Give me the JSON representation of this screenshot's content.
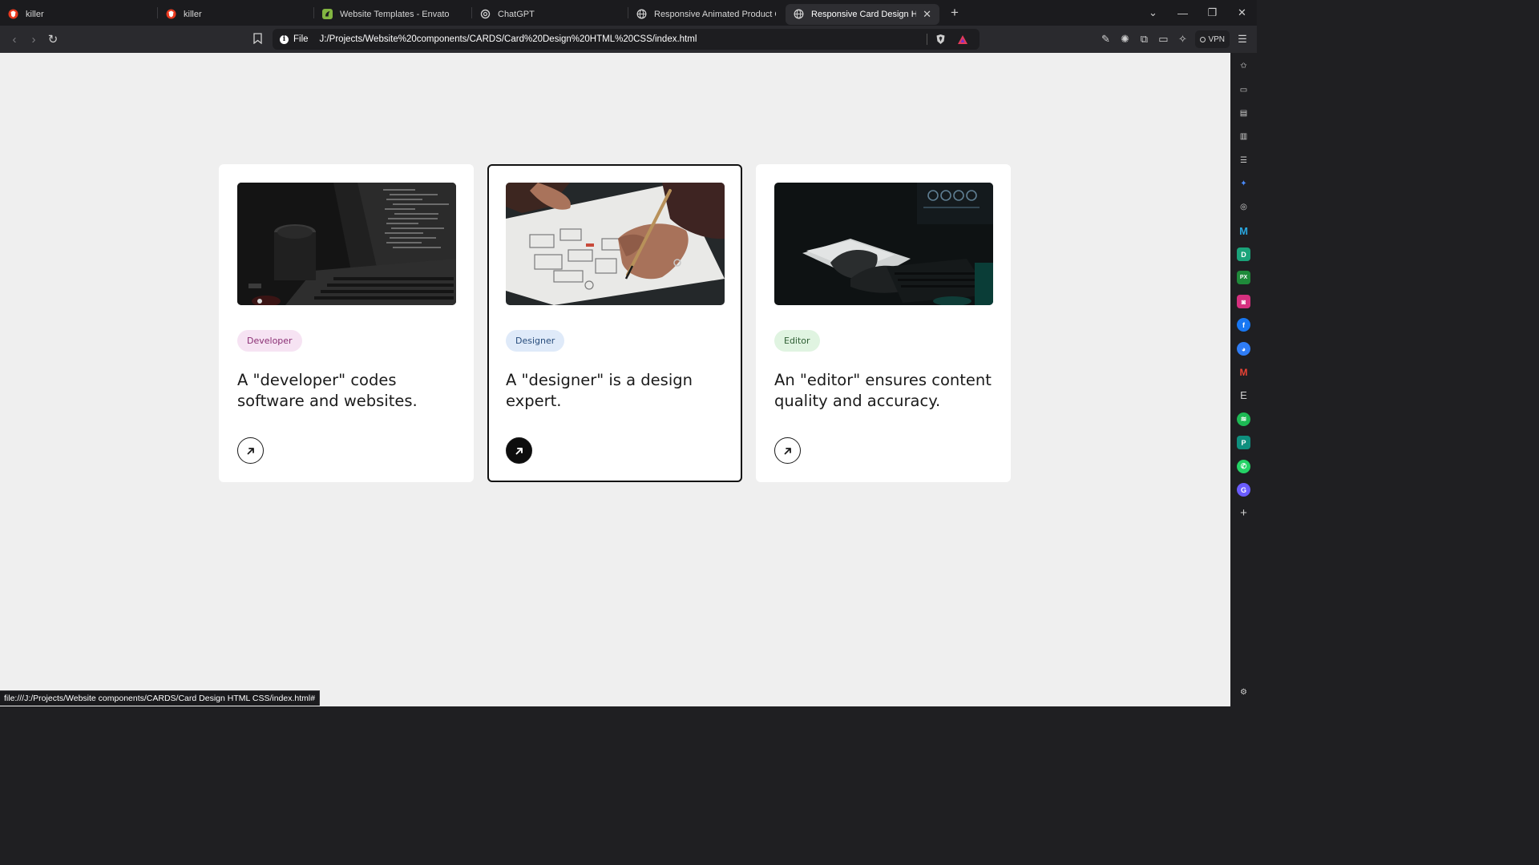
{
  "browser": {
    "tabs": [
      {
        "title": "killer",
        "icon": "brave-logo-icon",
        "active": false
      },
      {
        "title": "killer",
        "icon": "brave-logo-icon",
        "active": false
      },
      {
        "title": "Website Templates - Envato",
        "icon": "envato-icon",
        "active": false
      },
      {
        "title": "ChatGPT",
        "icon": "chatgpt-icon",
        "active": false
      },
      {
        "title": "Responsive Animated Product Card",
        "icon": "globe-icon",
        "active": false
      },
      {
        "title": "Responsive Card Design HTML",
        "icon": "globe-icon",
        "active": true
      }
    ],
    "site_info_label": "File",
    "url": "J:/Projects/Website%20components/CARDS/Card%20Design%20HTML%20CSS/index.html",
    "vpn_label": "VPN",
    "status_url": "file:///J:/Projects/Website components/CARDS/Card Design HTML CSS/index.html#"
  },
  "cards": [
    {
      "badge": "Developer",
      "badge_bg": "#f6e3f3",
      "badge_color": "#8a2f74",
      "text": "A \"developer\" codes software and websites.",
      "image": "laptop-code-photo",
      "selected": false
    },
    {
      "badge": "Designer",
      "badge_bg": "#dfeaf9",
      "badge_color": "#274c7c",
      "text": "A \"designer\" is a design expert.",
      "image": "wireframe-sketch-photo",
      "selected": true
    },
    {
      "badge": "Editor",
      "badge_bg": "#e0f4e1",
      "badge_color": "#2e5e33",
      "text": "An \"editor\" ensures content quality and accuracy.",
      "image": "editing-desk-photo",
      "selected": false
    }
  ],
  "colors": {
    "page_bg": "#efefef",
    "card_bg": "#ffffff",
    "selected_border": "#111111",
    "chrome_bg": "#1f1f22"
  }
}
